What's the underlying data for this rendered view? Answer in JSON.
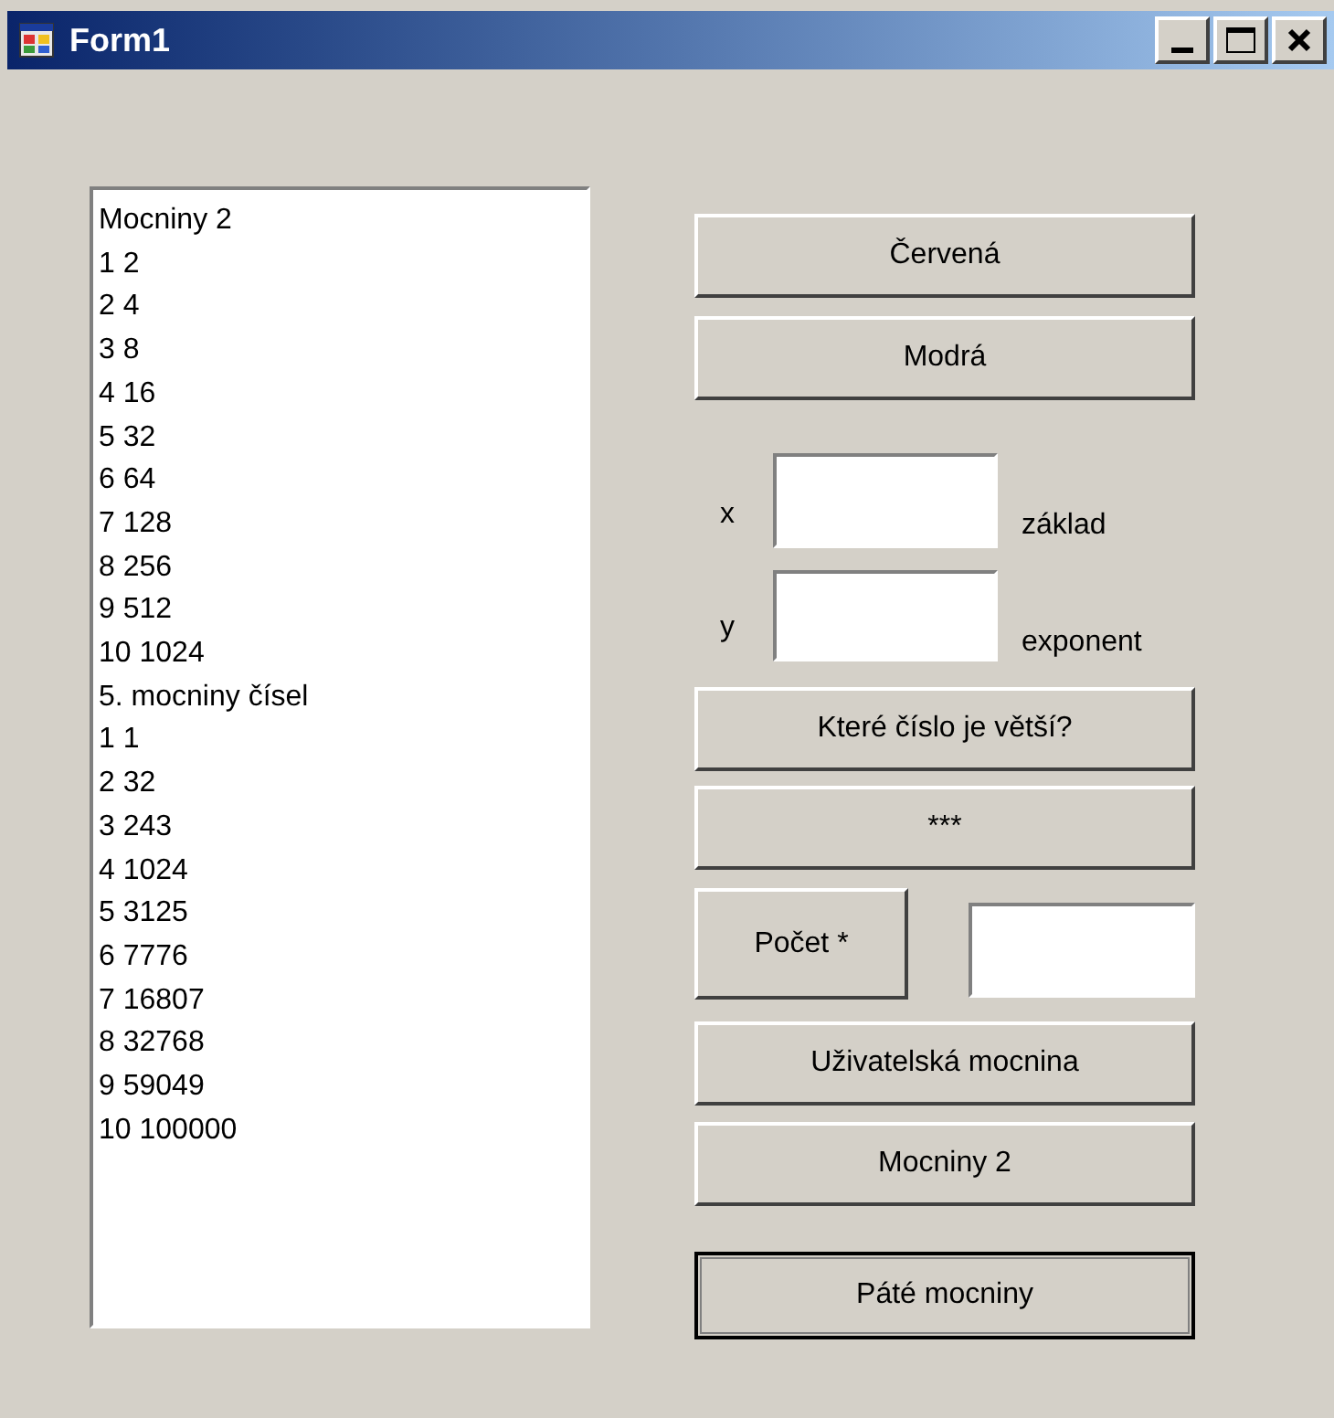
{
  "window": {
    "title": "Form1"
  },
  "listbox": {
    "items": [
      "Mocniny 2",
      "1 2",
      "2 4",
      "3 8",
      "4 16",
      "5 32",
      "6 64",
      "7 128",
      "8 256",
      "9 512",
      "10 1024",
      "5. mocniny čísel",
      "1 1",
      "2 32",
      "3 243",
      "4 1024",
      "5 3125",
      "6 7776",
      "7 16807",
      "8 32768",
      "9 59049",
      "10 100000"
    ]
  },
  "buttons_top": [
    {
      "label": "Červená",
      "focused": false
    },
    {
      "label": "Modrá",
      "focused": false
    }
  ],
  "fields": [
    {
      "label": "x",
      "caption": "základ"
    },
    {
      "label": "y",
      "caption": "exponent"
    }
  ],
  "buttons_mid": [
    {
      "label": "Které číslo je větší?",
      "focused": false
    },
    {
      "label": "***",
      "focused": false
    }
  ],
  "count": {
    "label": "Počet *",
    "focused": false
  },
  "buttons_bottom": [
    {
      "label": "Uživatelská mocnina",
      "focused": false
    },
    {
      "label": "Mocniny 2",
      "focused": false
    },
    {
      "label": "Páté mocniny",
      "focused": true
    }
  ]
}
